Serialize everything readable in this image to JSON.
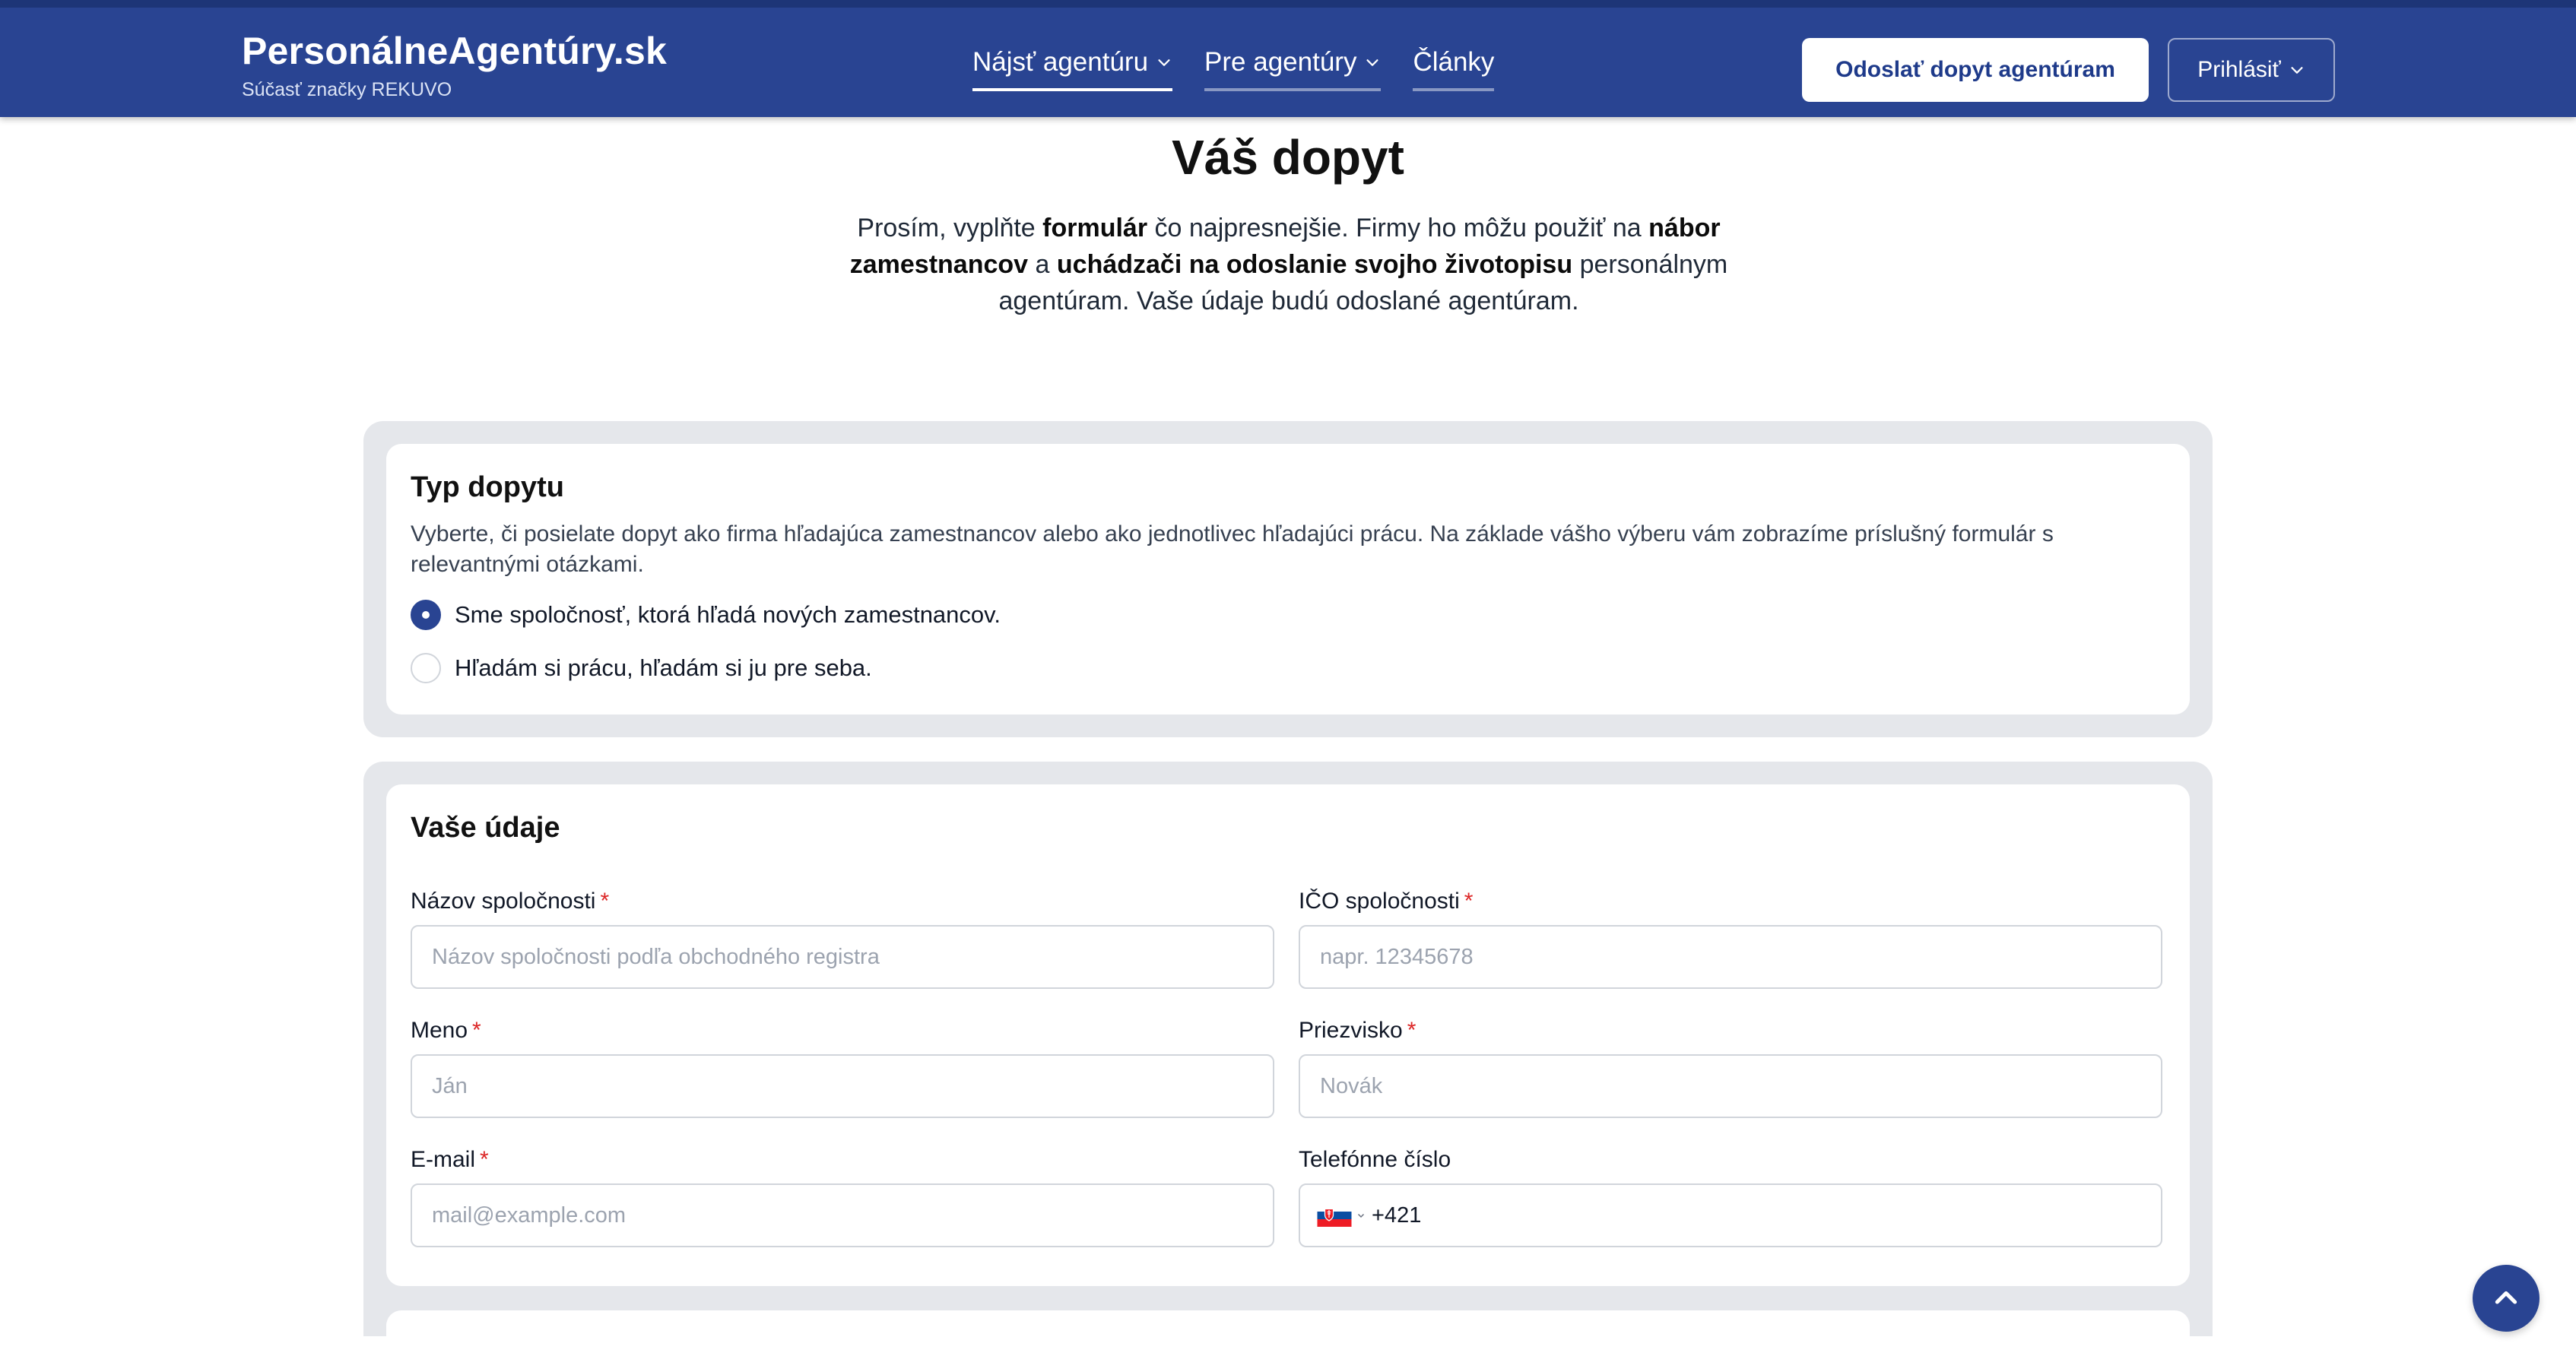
{
  "header": {
    "brand_title": "PersonálneAgentúry.sk",
    "brand_subtitle": "Súčasť značky REKUVO",
    "nav": [
      {
        "label": "Nájsť agentúru",
        "has_dropdown": true,
        "active": true
      },
      {
        "label": "Pre agentúry",
        "has_dropdown": true,
        "active": false
      },
      {
        "label": "Články",
        "has_dropdown": false,
        "active": false
      }
    ],
    "cta_label": "Odoslať dopyt agentúram",
    "login_label": "Prihlásiť"
  },
  "intro": {
    "title": "Váš dopyt",
    "p1": "Prosím, vyplňte ",
    "b1": "formulár",
    "p2": " čo najpresnejšie. Firmy ho môžu použiť na ",
    "b2": "nábor zamestnancov",
    "p3": " a ",
    "b3": "uchádzači na odoslanie svojho životopisu",
    "p4": " personálnym agentúram. Vaše údaje budú odoslané agentúram."
  },
  "request_type": {
    "title": "Typ dopytu",
    "description": "Vyberte, či posielate dopyt ako firma hľadajúca zamestnancov alebo ako jednotlivec hľadajúci prácu. Na základe vášho výberu vám zobrazíme príslušný formulár s relevantnými otázkami.",
    "options": [
      {
        "label": "Sme spoločnosť, ktorá hľadá nových zamestnancov.",
        "checked": true
      },
      {
        "label": "Hľadám si prácu, hľadám si ju pre seba.",
        "checked": false
      }
    ]
  },
  "details": {
    "title": "Vaše údaje",
    "required_mark": "*",
    "company_name": {
      "label": "Názov spoločnosti",
      "placeholder": "Názov spoločnosti podľa obchodného registra",
      "value": ""
    },
    "ico": {
      "label": "IČO spoločnosti",
      "placeholder": "napr. 12345678",
      "value": ""
    },
    "first_name": {
      "label": "Meno",
      "placeholder": "Ján",
      "value": ""
    },
    "last_name": {
      "label": "Priezvisko",
      "placeholder": "Novák",
      "value": ""
    },
    "email": {
      "label": "E-mail",
      "placeholder": "mail@example.com",
      "value": ""
    },
    "phone": {
      "label": "Telefónne číslo",
      "country_flag": "slovakia-flag-icon",
      "value": "+421"
    }
  },
  "colors": {
    "primary": "#294492",
    "required": "#dc2626",
    "card_bg": "#e5e7eb"
  },
  "icons": {
    "scroll_top": "chevron-up-icon",
    "dropdown": "chevron-down-icon"
  }
}
